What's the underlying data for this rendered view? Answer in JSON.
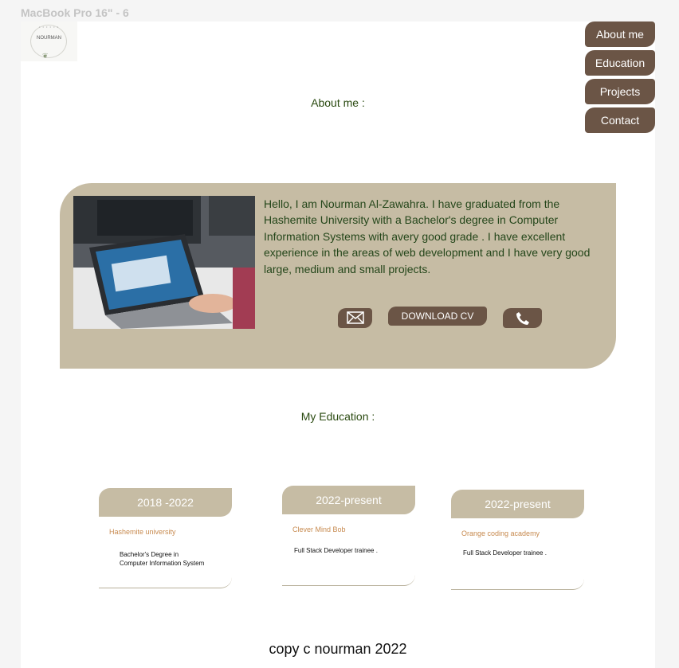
{
  "frame": {
    "label": "MacBook Pro 16\" - 6"
  },
  "logo": {
    "text": "NOURMAN",
    "top": "• • • • • •"
  },
  "nav": {
    "items": [
      "About me",
      "Education",
      "Projects",
      "Contact"
    ]
  },
  "about": {
    "title": "About me :",
    "text": "Hello, I am Nourman Al-Zawahra. I have graduated from the Hashemite University with a Bachelor's degree in Computer Information Systems with avery good grade . I have excellent experience in the areas of web development and I have very good large, medium and small projects.",
    "cv_label": "DOWNLOAD CV"
  },
  "education": {
    "title": "My Education :",
    "cards": [
      {
        "years": "2018 -2022",
        "school": "Hashemite university",
        "degree": "Bachelor's Degree in Computer Information System"
      },
      {
        "years": "2022-present",
        "school": "Clever Mind Bob",
        "degree": "Full Stack Developer trainee ."
      },
      {
        "years": "2022-present",
        "school": "Orange coding academy",
        "degree": "Full Stack Developer trainee ."
      }
    ]
  },
  "footer": {
    "text": "copy c nourman 2022"
  },
  "colors": {
    "accent": "#6b5546",
    "card": "#c6bca4",
    "text_green": "#24461a",
    "school": "#c78a4f"
  }
}
